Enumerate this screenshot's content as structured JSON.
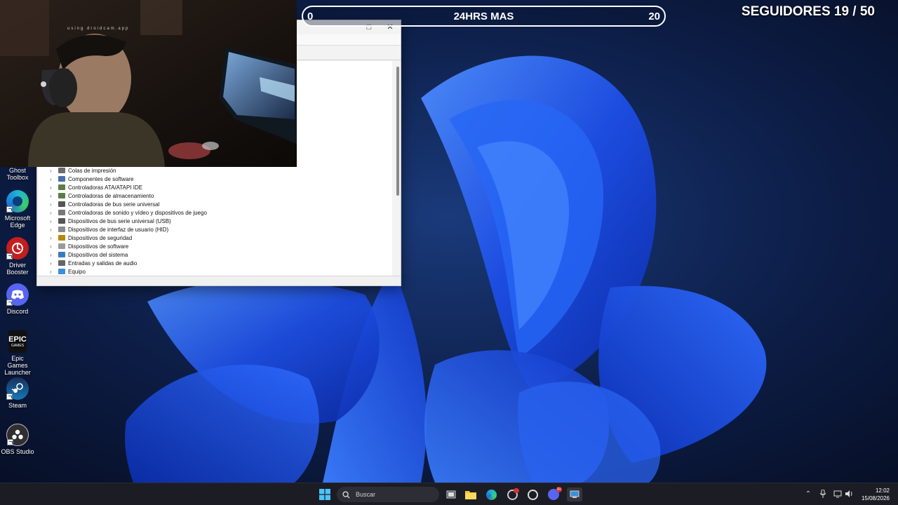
{
  "overlay": {
    "goal_left": "0",
    "goal_title": "24HRS MAS",
    "goal_right": "20",
    "followers": "SEGUIDORES 19 / 50"
  },
  "webcam": {
    "watermark": "using droidcam.app"
  },
  "desktop_icons": [
    {
      "label": "Ghost Toolbox",
      "icon": "ghost-toolbox-icon"
    },
    {
      "label": "Microsoft Edge",
      "icon": "edge-icon"
    },
    {
      "label": "Driver Booster",
      "icon": "driver-booster-icon"
    },
    {
      "label": "Discord",
      "icon": "discord-icon"
    },
    {
      "label": "Epic Games Launcher",
      "icon": "epic-games-icon",
      "logo_text": "EPIC GAMES"
    },
    {
      "label": "Steam",
      "icon": "steam-icon"
    },
    {
      "label": "OBS Studio",
      "icon": "obs-icon"
    }
  ],
  "device_manager": {
    "tree_items": [
      {
        "label": "Colas de impresión",
        "icon": "printer-icon",
        "color": "#6b6b6b"
      },
      {
        "label": "Componentes de software",
        "icon": "software-component-icon",
        "color": "#4a6fa5"
      },
      {
        "label": "Controladoras ATA/ATAPI IDE",
        "icon": "ide-controller-icon",
        "color": "#5a7d4a"
      },
      {
        "label": "Controladoras de almacenamiento",
        "icon": "storage-controller-icon",
        "color": "#5a7d4a"
      },
      {
        "label": "Controladoras de bus serie universal",
        "icon": "usb-controller-icon",
        "color": "#555555"
      },
      {
        "label": "Controladoras de sonido y vídeo y dispositivos de juego",
        "icon": "sound-icon",
        "color": "#777777"
      },
      {
        "label": "Dispositivos de bus serie universal (USB)",
        "icon": "usb-device-icon",
        "color": "#555555"
      },
      {
        "label": "Dispositivos de interfaz de usuario (HID)",
        "icon": "hid-icon",
        "color": "#8a8a8a"
      },
      {
        "label": "Dispositivos de seguridad",
        "icon": "security-device-icon",
        "color": "#b8860b"
      },
      {
        "label": "Dispositivos de software",
        "icon": "software-device-icon",
        "color": "#9a9a9a"
      },
      {
        "label": "Dispositivos del sistema",
        "icon": "system-device-icon",
        "color": "#3a7bbf"
      },
      {
        "label": "Entradas y salidas de audio",
        "icon": "audio-io-icon",
        "color": "#666666"
      },
      {
        "label": "Equipo",
        "icon": "computer-icon",
        "color": "#3a8fd8"
      }
    ]
  },
  "taskbar": {
    "search_placeholder": "Buscar",
    "time": "12:02",
    "date": "15/08/2026",
    "apps": [
      {
        "name": "task-view-icon"
      },
      {
        "name": "file-explorer-icon"
      },
      {
        "name": "edge-taskbar-icon"
      },
      {
        "name": "chrome-taskbar-icon"
      },
      {
        "name": "app-taskbar-icon"
      },
      {
        "name": "discord-taskbar-icon",
        "badge": "9+"
      },
      {
        "name": "device-manager-taskbar-icon"
      }
    ]
  },
  "colors": {
    "wallpaper_dark": "#0a1533",
    "bloom_blue": "#1f4fe0",
    "overlay_text": "#ffffff"
  }
}
